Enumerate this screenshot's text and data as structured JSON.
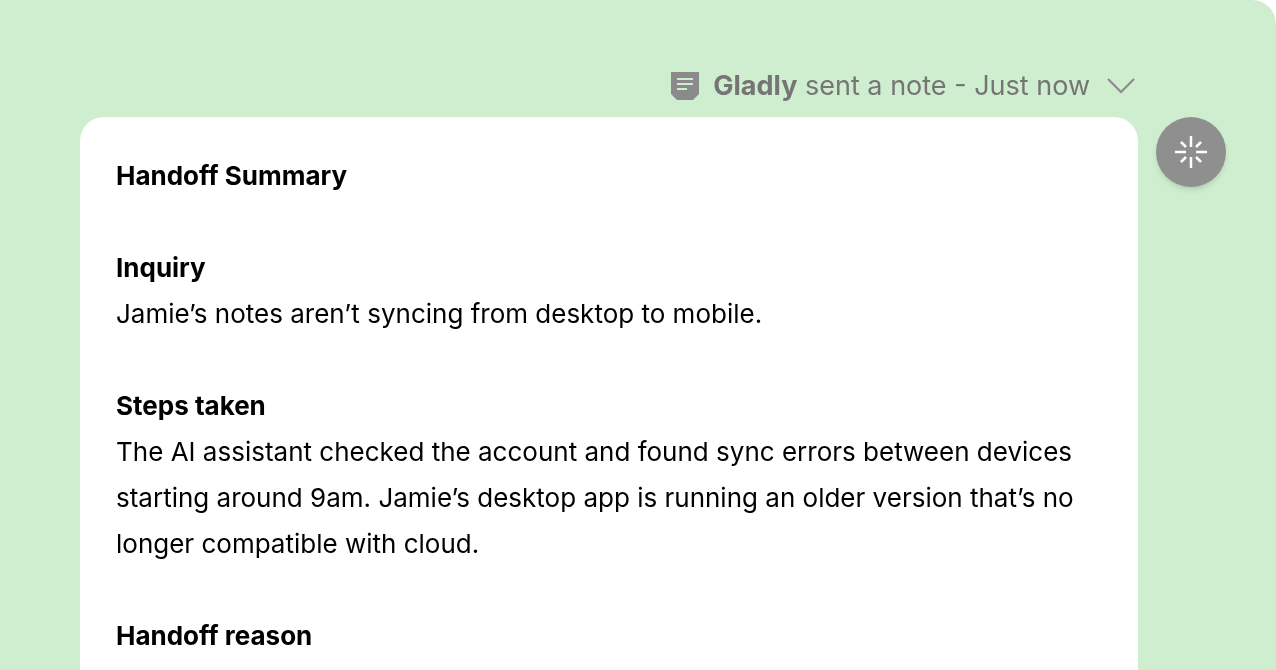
{
  "note_header": {
    "text": "**Gladly** sent a note - Just now",
    "expanded": false
  },
  "note": {
    "title": "Handoff Summary",
    "sections": [
      {
        "heading": "Inquiry",
        "body": "Jamie’s notes aren’t syncing from desktop to mobile."
      },
      {
        "heading": "Steps taken",
        "body": "The AI assistant checked the account and found sync errors between devices starting around 9am. Jamie’s desktop app is running an older version that’s no longer compatible with cloud."
      },
      {
        "heading": "Handoff reason"
      }
    ]
  }
}
